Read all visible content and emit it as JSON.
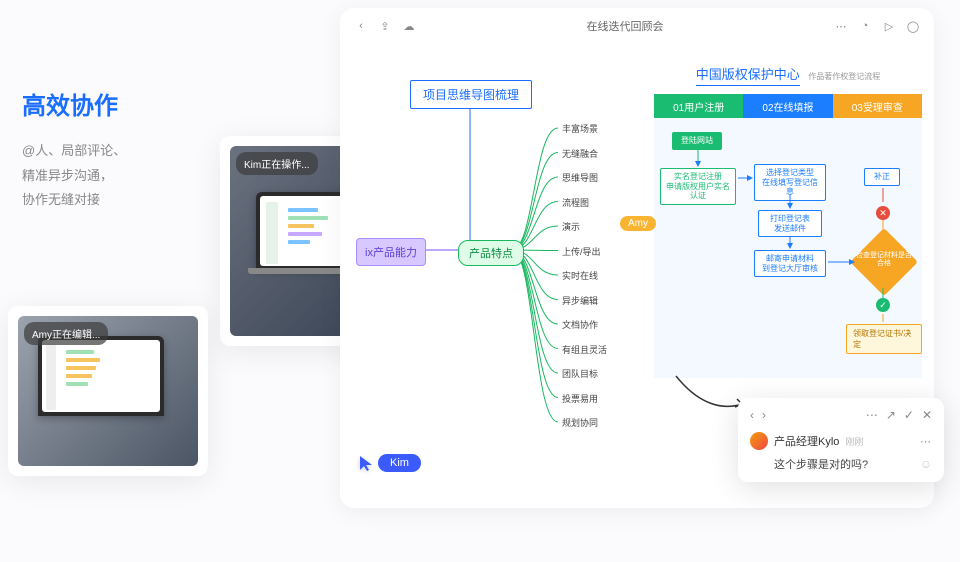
{
  "left": {
    "title": "高效协作",
    "line1": "@人、局部评论、",
    "line2": "精准异步沟通，",
    "line3": "协作无缝对接"
  },
  "photo_badges": {
    "kim": "Kim正在操作...",
    "amy": "Amy正在编辑..."
  },
  "toolbar": {
    "title": "在线迭代回顾会"
  },
  "mindmap": {
    "title": "项目思维导图梳理",
    "root": "ix产品能力",
    "hub": "产品特点",
    "leaves": [
      "丰富场景",
      "无缝融合",
      "思维导图",
      "流程图",
      "演示",
      "上传/导出",
      "实时在线",
      "异步编辑",
      "文档协作",
      "有组且灵活",
      "团队目标",
      "投票易用",
      "规划协同"
    ]
  },
  "flowchart": {
    "title_main": "中国版权保护中心",
    "title_sub": "作品著作权登记流程",
    "cols": [
      "01用户注册",
      "02在线填报",
      "03受理审查"
    ],
    "boxes": {
      "green_btn": "登陆网站",
      "green_outline": "实名登记注册\n申请版权用户实名认证",
      "blue1": "选择登记类型\n在线填写登记信息",
      "blue2": "打印登记表\n发送邮件",
      "blue3": "邮寄申请材料\n到登记大厅审核",
      "fix": "补正",
      "diamond": "检查登记材料是否合格",
      "result": "领取登记证书/决定"
    }
  },
  "amy_chip": "Amy",
  "kim_chip": "Kim",
  "comment": {
    "name": "产品经理Kylo",
    "time": "刚刚",
    "msg": "这个步骤是对的吗?"
  }
}
